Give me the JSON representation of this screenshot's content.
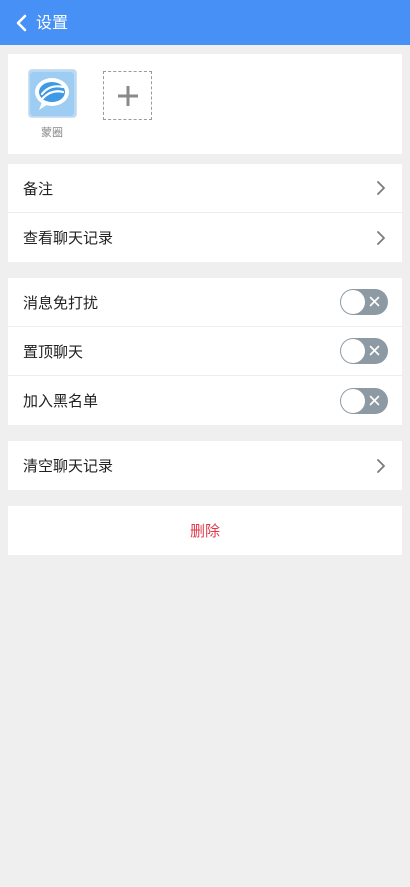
{
  "header": {
    "title": "设置",
    "back_icon": "chevron-left-icon"
  },
  "members": [
    {
      "name": "蒙圈",
      "avatar_icon": "chat-bubble-logo-icon"
    }
  ],
  "add_member": {
    "icon": "plus-icon"
  },
  "group1": [
    {
      "label": "备注"
    },
    {
      "label": "查看聊天记录"
    }
  ],
  "toggles": [
    {
      "label": "消息免打扰",
      "enabled": false
    },
    {
      "label": "置顶聊天",
      "enabled": false
    },
    {
      "label": "加入黑名单",
      "enabled": false
    }
  ],
  "clear_history": {
    "label": "清空聊天记录"
  },
  "delete_button": {
    "label": "删除"
  },
  "colors": {
    "header_bg": "#4791f6",
    "page_bg": "#efefef",
    "toggle_off": "#8e9aa3",
    "delete_text": "#e2394a"
  }
}
